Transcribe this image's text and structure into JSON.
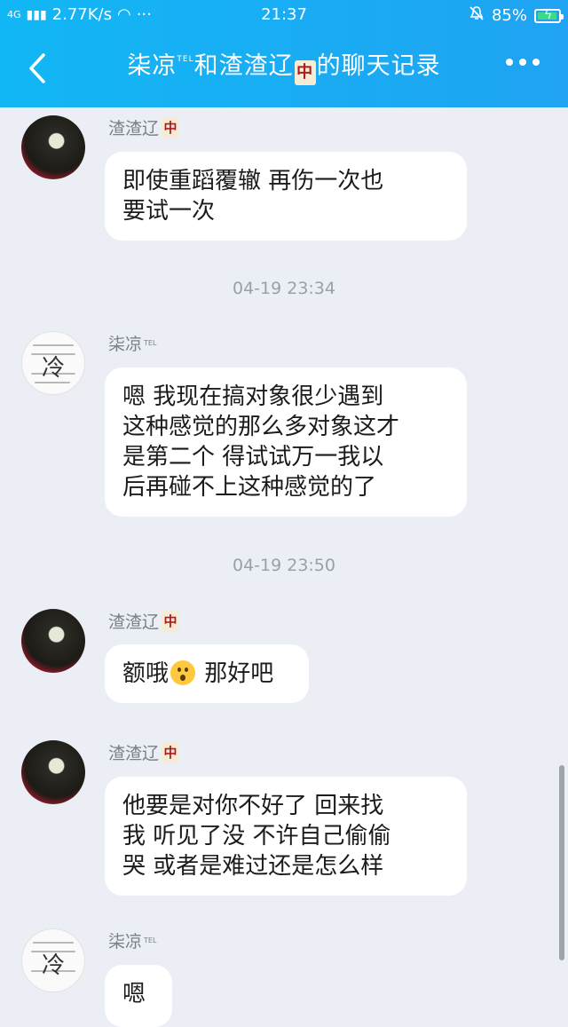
{
  "status": {
    "network": "4G",
    "speed": "2.77K/s",
    "dots": "···",
    "time": "21:37",
    "battery": "85%",
    "battery_level": 0.85
  },
  "header": {
    "title_part1": "柒凉",
    "title_sup1": "TEL",
    "title_part2": "和渣渣辽",
    "title_tile": "中",
    "title_part3": "的聊天记录"
  },
  "messages": [
    {
      "sender": "渣渣辽",
      "sender_tile": "中",
      "lines": [
        "即使重蹈覆辙 再伤一次也",
        "要试一次"
      ]
    },
    {
      "timestamp": "04-19 23:34"
    },
    {
      "sender": "柒凉",
      "sender_sup": "TEL",
      "lines": [
        "嗯 我现在搞对象很少遇到",
        "这种感觉的那么多对象这才",
        "是第二个 得试试万一我以",
        "后再碰不上这种感觉的了"
      ]
    },
    {
      "timestamp": "04-19 23:50"
    },
    {
      "sender": "渣渣辽",
      "sender_tile": "中",
      "text_before": "额哦",
      "emoji": "astonished-face",
      "text_after": "那好吧"
    },
    {
      "sender": "渣渣辽",
      "sender_tile": "中",
      "lines": [
        "他要是对你不好了 回来找",
        "我 听见了没 不许自己偷偷",
        "哭 或者是难过还是怎么样"
      ]
    },
    {
      "sender": "柒凉",
      "sender_sup": "TEL",
      "lines": [
        "嗯"
      ]
    }
  ],
  "avatar_calligraphy": "冷"
}
